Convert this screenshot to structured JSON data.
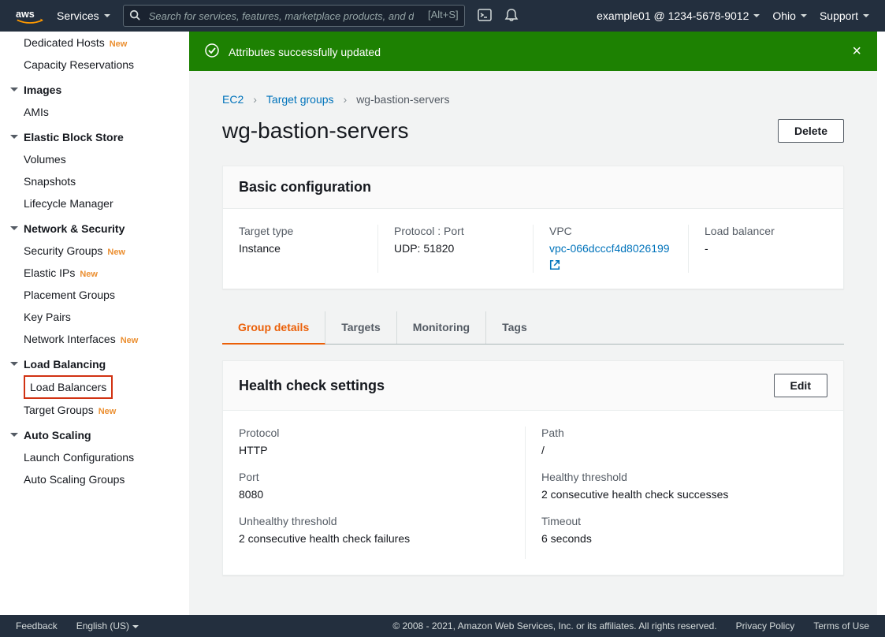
{
  "nav": {
    "services": "Services",
    "search_placeholder": "Search for services, features, marketplace products, and docs",
    "alt_s": "[Alt+S]",
    "account": "example01 @ 1234-5678-9012",
    "region": "Ohio",
    "support": "Support"
  },
  "sidebar": {
    "dedicated_hosts": "Dedicated Hosts",
    "capacity_reservations": "Capacity Reservations",
    "images": "Images",
    "amis": "AMIs",
    "ebs": "Elastic Block Store",
    "volumes": "Volumes",
    "snapshots": "Snapshots",
    "lifecycle": "Lifecycle Manager",
    "netsec": "Network & Security",
    "security_groups": "Security Groups",
    "elastic_ips": "Elastic IPs",
    "placement_groups": "Placement Groups",
    "key_pairs": "Key Pairs",
    "network_interfaces": "Network Interfaces",
    "load_balancing": "Load Balancing",
    "load_balancers": "Load Balancers",
    "target_groups": "Target Groups",
    "auto_scaling": "Auto Scaling",
    "launch_configs": "Launch Configurations",
    "asg": "Auto Scaling Groups",
    "new": "New"
  },
  "flash": {
    "message": "Attributes successfully updated"
  },
  "breadcrumb": {
    "ec2": "EC2",
    "target_groups": "Target groups",
    "current": "wg-bastion-servers"
  },
  "page": {
    "title": "wg-bastion-servers",
    "delete": "Delete"
  },
  "basic": {
    "heading": "Basic configuration",
    "target_type_label": "Target type",
    "target_type": "Instance",
    "protocol_label": "Protocol : Port",
    "protocol": "UDP: 51820",
    "vpc_label": "VPC",
    "vpc": "vpc-066dcccf4d8026199",
    "lb_label": "Load balancer",
    "lb": "-"
  },
  "tabs": {
    "group_details": "Group details",
    "targets": "Targets",
    "monitoring": "Monitoring",
    "tags": "Tags"
  },
  "health": {
    "heading": "Health check settings",
    "edit": "Edit",
    "protocol_label": "Protocol",
    "protocol": "HTTP",
    "port_label": "Port",
    "port": "8080",
    "unhealthy_label": "Unhealthy threshold",
    "unhealthy": "2 consecutive health check failures",
    "path_label": "Path",
    "path": "/",
    "healthy_label": "Healthy threshold",
    "healthy": "2 consecutive health check successes",
    "timeout_label": "Timeout",
    "timeout": "6 seconds"
  },
  "footer": {
    "feedback": "Feedback",
    "language": "English (US)",
    "copyright": "© 2008 - 2021, Amazon Web Services, Inc. or its affiliates. All rights reserved.",
    "privacy": "Privacy Policy",
    "terms": "Terms of Use"
  }
}
